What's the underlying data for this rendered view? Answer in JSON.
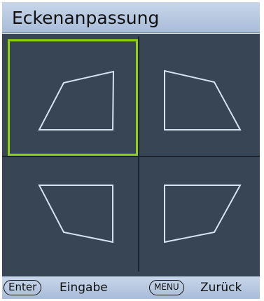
{
  "title": "Eckenanpassung",
  "tiles": [
    {
      "name": "corner-top-left",
      "selected": true
    },
    {
      "name": "corner-top-right",
      "selected": false
    },
    {
      "name": "corner-bottom-left",
      "selected": false
    },
    {
      "name": "corner-bottom-right",
      "selected": false
    }
  ],
  "footer": {
    "enter_key": "Enter",
    "enter_action": "Eingabe",
    "menu_key": "MENU",
    "menu_action": "Zurück"
  },
  "colors": {
    "selection": "#8fd20b",
    "tile_bg": "#374555",
    "shape_stroke": "#d6e2ee"
  }
}
